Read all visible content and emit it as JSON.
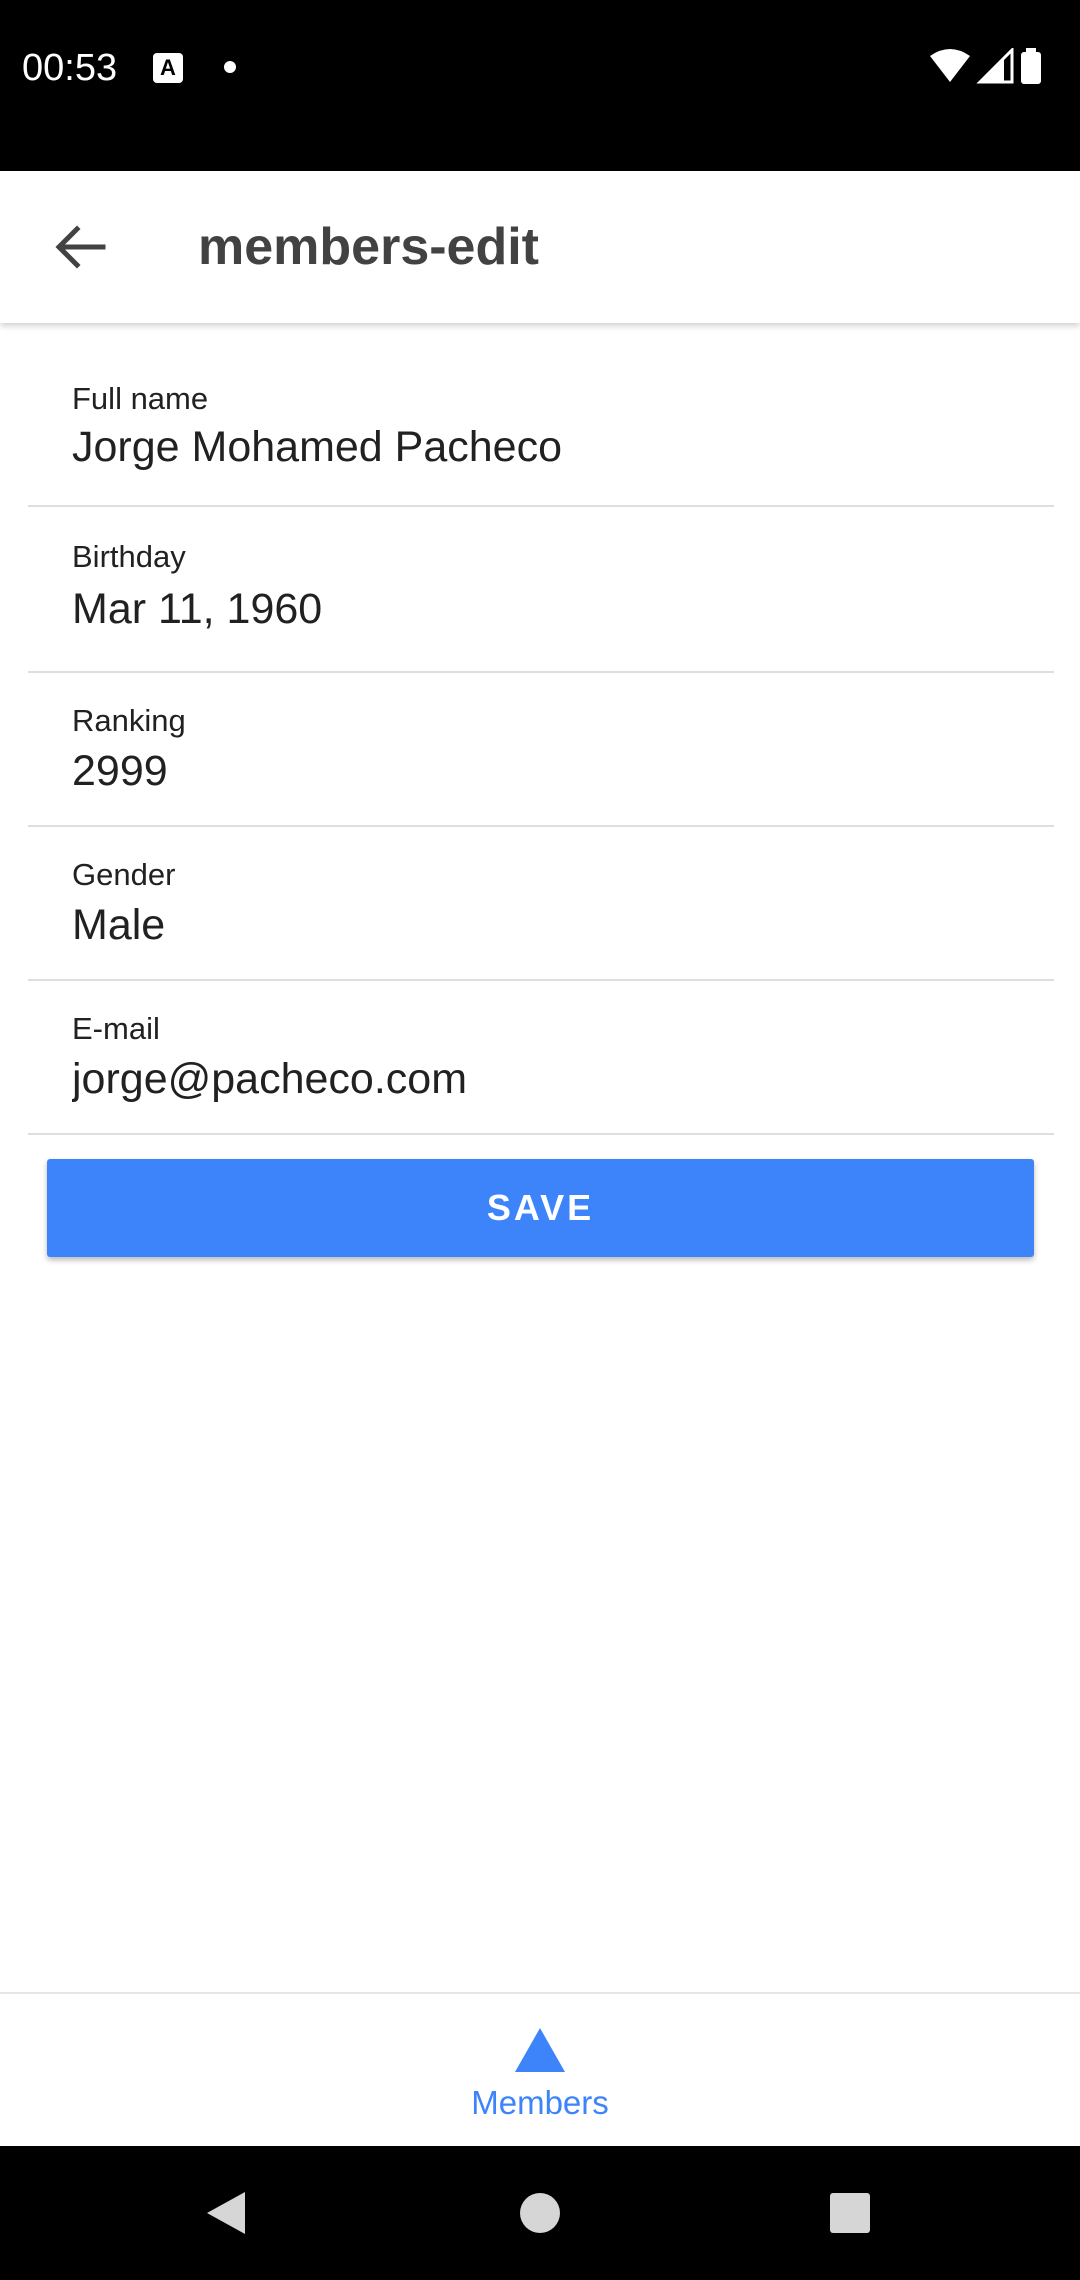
{
  "status_bar": {
    "time": "00:53",
    "notification_icon": "A",
    "icons": [
      "wifi-icon",
      "cell-signal-icon",
      "battery-icon"
    ]
  },
  "app_bar": {
    "title": "members-edit",
    "back_icon": "arrow-left-icon"
  },
  "form": {
    "fields": [
      {
        "label": "Full name",
        "value": "Jorge Mohamed Pacheco"
      },
      {
        "label": "Birthday",
        "value": "Mar 11, 1960"
      },
      {
        "label": "Ranking",
        "value": "2999"
      },
      {
        "label": "Gender",
        "value": "Male"
      },
      {
        "label": "E-mail",
        "value": "jorge@pacheco.com"
      }
    ],
    "save_label": "SAVE"
  },
  "bottom_nav": {
    "items": [
      {
        "label": "Members",
        "icon": "triangle-icon",
        "active": true
      }
    ]
  },
  "colors": {
    "accent": "#3d84fb",
    "title": "#424242",
    "divider": "#dedede"
  }
}
